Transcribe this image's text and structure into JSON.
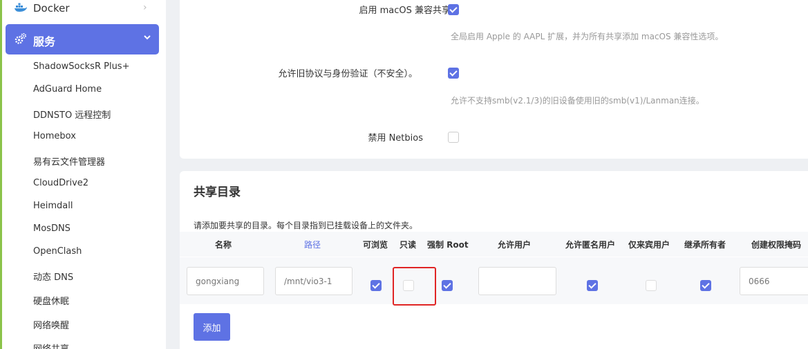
{
  "sidebar": {
    "docker_label": "Docker",
    "service_label": "服务",
    "items": [
      "ShadowSocksR Plus+",
      "AdGuard Home",
      "DDNSTO 远程控制",
      "Homebox",
      "易有云文件管理器",
      "CloudDrive2",
      "Heimdall",
      "MosDNS",
      "OpenClash",
      "动态 DNS",
      "硬盘休眠",
      "网络唤醒",
      "网络共享"
    ]
  },
  "settings": {
    "macos_label": "启用 macOS 兼容共享",
    "macos_desc": "全局启用 Apple 的 AAPL 扩展，并为所有共享添加 macOS 兼容性选项。",
    "macos_checked": true,
    "legacy_label": "允许旧协议与身份验证（不安全）。",
    "legacy_desc": "允许不支持smb(v2.1/3)的旧设备使用旧的smb(v1)/Lanman连接。",
    "legacy_checked": true,
    "netbios_label": "禁用 Netbios",
    "netbios_checked": false
  },
  "shares": {
    "title": "共享目录",
    "description": "请添加要共享的目录。每个目录指到已挂载设备上的文件夹。",
    "columns": [
      "名称",
      "路径",
      "可浏览",
      "只读",
      "强制 Root",
      "允许用户",
      "允许匿名用户",
      "仅来宾用户",
      "继承所有者",
      "创建权限掩码"
    ],
    "row": {
      "name": "gongxiang",
      "path": "/mnt/vio3-1",
      "browseable": true,
      "read_only": false,
      "force_root": true,
      "users": "",
      "guest_ok": true,
      "guest_only": false,
      "inherit_owner": true,
      "create_mask": "0666"
    },
    "add_label": "添加"
  },
  "colors": {
    "accent": "#5e72e4",
    "sidebar_border": "#8bc34a",
    "highlight": "#e02424"
  }
}
